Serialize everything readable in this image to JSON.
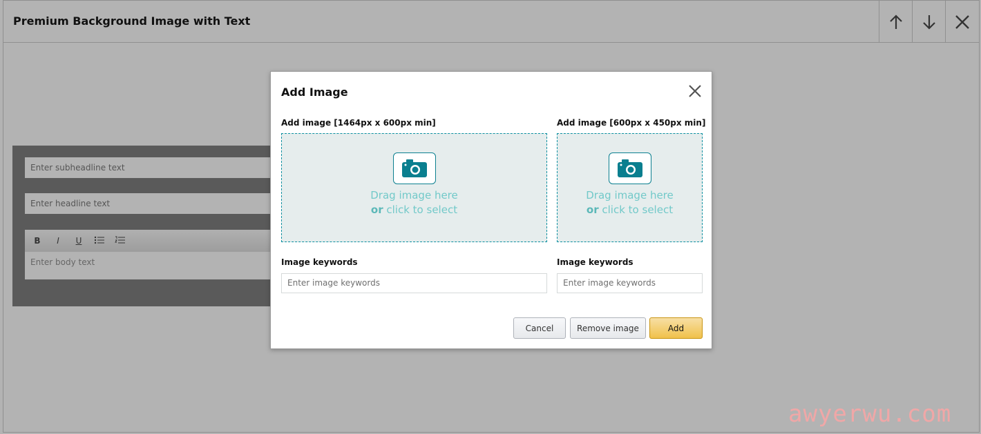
{
  "header": {
    "title": "Premium Background Image with Text"
  },
  "icons": {
    "move_up": "arrow-up-icon",
    "move_down": "arrow-down-icon",
    "close": "close-icon",
    "camera": "camera-icon"
  },
  "editor": {
    "subheadline_placeholder": "Enter subheadline text",
    "headline_placeholder": "Enter headline text",
    "toolbar": {
      "bold": "B",
      "italic": "I",
      "underline": "U"
    },
    "body_placeholder": "Enter body text"
  },
  "modal": {
    "title": "Add Image",
    "left": {
      "label": "Add image [1464px x 600px min]",
      "drop_line1": "Drag image here",
      "drop_or": "or",
      "drop_line2": " click to select",
      "keywords_label": "Image keywords",
      "keywords_placeholder": "Enter image keywords"
    },
    "right": {
      "label": "Add image [600px x 450px min]",
      "drop_line1": "Drag image here",
      "drop_or": "or",
      "drop_line2": " click to select",
      "keywords_label": "Image keywords",
      "keywords_placeholder": "Enter image keywords"
    },
    "buttons": {
      "cancel": "Cancel",
      "remove": "Remove image",
      "add": "Add"
    }
  },
  "watermark": "awyerwu.com",
  "colors": {
    "accent": "#0a8fa0",
    "primary_button": "#f0c14b",
    "overlay": "#b3b3b3"
  }
}
